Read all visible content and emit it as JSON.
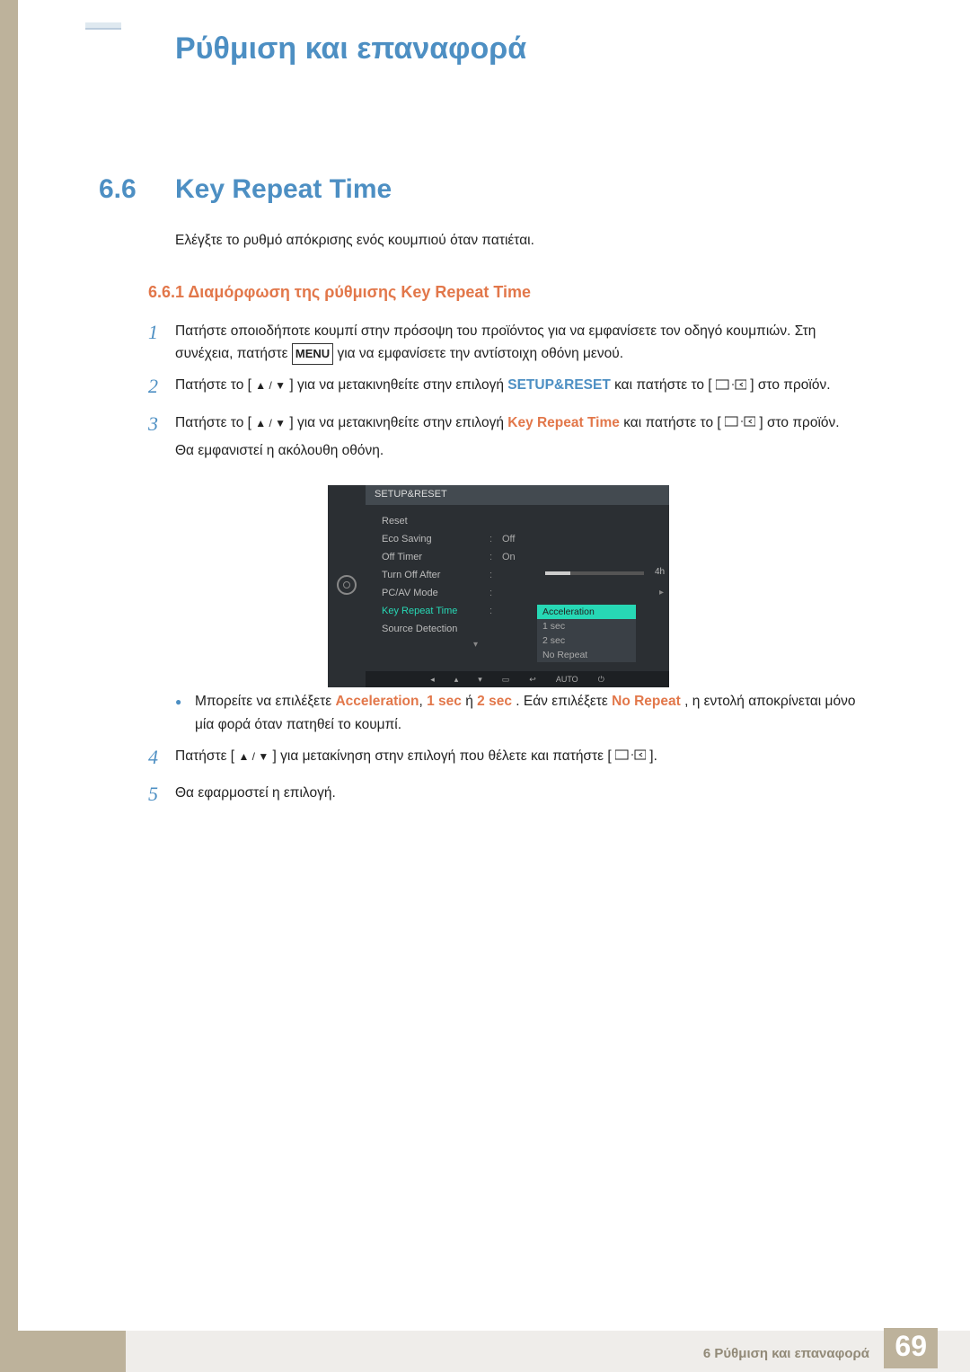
{
  "header": {
    "chapter_title": "Ρύθμιση και επαναφορά"
  },
  "section": {
    "num": "6.6",
    "title": "Key Repeat Time",
    "intro": "Ελέγξτε το ρυθμό απόκρισης ενός κουμπιού όταν πατιέται.",
    "subsec": "6.6.1   Διαμόρφωση της ρύθμισης Key Repeat Time"
  },
  "steps": {
    "s1a": "Πατήστε οποιοδήποτε κουμπί στην πρόσοψη του προϊόντος για να εμφανίσετε τον οδηγό κουμπιών. Στη συνέχεια, πατήστε ",
    "s1_menu": "MENU",
    "s1b": " για να εμφανίσετε την αντίστοιχη οθόνη μενού.",
    "s2a": "Πατήστε το [",
    "s2b": "] για να μετακινηθείτε στην επιλογή ",
    "s2_hl": "SETUP&RESET",
    "s2c": " και πατήστε το [",
    "s2d": "] στο προϊόν.",
    "s3a": "Πατήστε το [",
    "s3b": "] για να μετακινηθείτε στην επιλογή ",
    "s3_hl": "Key Repeat Time",
    "s3c": " και πατήστε το [",
    "s3d": "] στο προϊόν.",
    "s3e": "Θα εμφανιστεί η ακόλουθη οθόνη.",
    "bullet_a": "Μπορείτε να επιλέξετε ",
    "opt1": "Acceleration",
    "opt2": "1 sec",
    "or": " ή ",
    "opt3": "2 sec",
    "bullet_b": ". Εάν επιλέξετε ",
    "opt4": "No Repeat",
    "bullet_c": ", η εντολή αποκρίνεται μόνο μία φορά όταν πατηθεί το κουμπί.",
    "s4a": "Πατήστε [",
    "s4b": "] για μετακίνηση στην επιλογή που θέλετε και πατήστε [",
    "s4c": "].",
    "s5": "Θα εφαρμοστεί η επιλογή."
  },
  "osd": {
    "title": "SETUP&RESET",
    "rows": [
      {
        "label": "Reset",
        "val": ""
      },
      {
        "label": "Eco Saving",
        "val": "Off"
      },
      {
        "label": "Off Timer",
        "val": "On"
      },
      {
        "label": "Turn Off After",
        "val": "4h"
      },
      {
        "label": "PC/AV Mode",
        "val": ""
      },
      {
        "label": "Key Repeat Time",
        "val": ""
      },
      {
        "label": "Source Detection",
        "val": ""
      }
    ],
    "dropdown": [
      "Acceleration",
      "1 sec",
      "2 sec",
      "No Repeat"
    ],
    "foot_auto": "AUTO"
  },
  "footer": {
    "text": "6 Ρύθμιση και επαναφορά",
    "page": "69"
  }
}
